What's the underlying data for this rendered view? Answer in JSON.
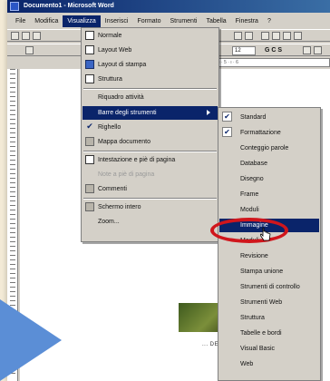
{
  "window": {
    "title": "Documento1 - Microsoft Word"
  },
  "menubar": {
    "items": [
      {
        "label": "File",
        "active": false
      },
      {
        "label": "Modifica",
        "active": false
      },
      {
        "label": "Visualizza",
        "active": true
      },
      {
        "label": "Inserisci",
        "active": false
      },
      {
        "label": "Formato",
        "active": false
      },
      {
        "label": "Strumenti",
        "active": false
      },
      {
        "label": "Tabella",
        "active": false
      },
      {
        "label": "Finestra",
        "active": false
      },
      {
        "label": "?",
        "active": false
      }
    ]
  },
  "toolbar": {
    "font_size": "12",
    "format_letters": "G C S"
  },
  "view_menu": {
    "items": [
      {
        "label": "Normale",
        "icon": "normal-view-icon",
        "state": "normal"
      },
      {
        "label": "Layout Web",
        "icon": "web-layout-icon",
        "state": "normal"
      },
      {
        "label": "Layout di stampa",
        "icon": "print-layout-icon",
        "state": "normal"
      },
      {
        "label": "Struttura",
        "icon": "outline-view-icon",
        "state": "normal"
      },
      {
        "label": "Riquadro attività",
        "icon": "",
        "state": "normal"
      },
      {
        "label": "Barre degli strumenti",
        "icon": "",
        "state": "highlighted",
        "submenu": true
      },
      {
        "label": "Righello",
        "icon": "check-icon",
        "state": "normal"
      },
      {
        "label": "Mappa documento",
        "icon": "document-map-icon",
        "state": "normal"
      },
      {
        "label": "Intestazione e piè di pagina",
        "icon": "header-footer-icon",
        "state": "normal"
      },
      {
        "label": "Note a piè di pagina",
        "icon": "",
        "state": "disabled"
      },
      {
        "label": "Commenti",
        "icon": "comments-icon",
        "state": "normal"
      },
      {
        "label": "Schermo intero",
        "icon": "full-screen-icon",
        "state": "normal"
      },
      {
        "label": "Zoom...",
        "icon": "",
        "state": "normal"
      }
    ]
  },
  "toolbars_submenu": {
    "items": [
      {
        "label": "Standard",
        "checked": true
      },
      {
        "label": "Formattazione",
        "checked": true
      },
      {
        "label": "Conteggio parole",
        "checked": false
      },
      {
        "label": "Database",
        "checked": false
      },
      {
        "label": "Disegno",
        "checked": false
      },
      {
        "label": "Frame",
        "checked": false
      },
      {
        "label": "Moduli",
        "checked": false
      },
      {
        "label": "Immagine",
        "checked": false,
        "highlighted": true
      },
      {
        "label": "Moduli",
        "checked": false
      },
      {
        "label": "Revisione",
        "checked": false
      },
      {
        "label": "Stampa unione",
        "checked": false
      },
      {
        "label": "Strumenti di controllo",
        "checked": false
      },
      {
        "label": "Strumenti Web",
        "checked": false
      },
      {
        "label": "Struttura",
        "checked": false
      },
      {
        "label": "Tabelle e bordi",
        "checked": false
      },
      {
        "label": "Visual Basic",
        "checked": false
      },
      {
        "label": "Web",
        "checked": false
      }
    ]
  },
  "document": {
    "visible_text": "... DEWB"
  },
  "colors": {
    "highlight": "#0a246a",
    "menu_bg": "#d4d0c8",
    "annotation_red": "#d0161c",
    "annotation_arrow": "#5b8ed6",
    "page_bg": "#f3ead6"
  }
}
